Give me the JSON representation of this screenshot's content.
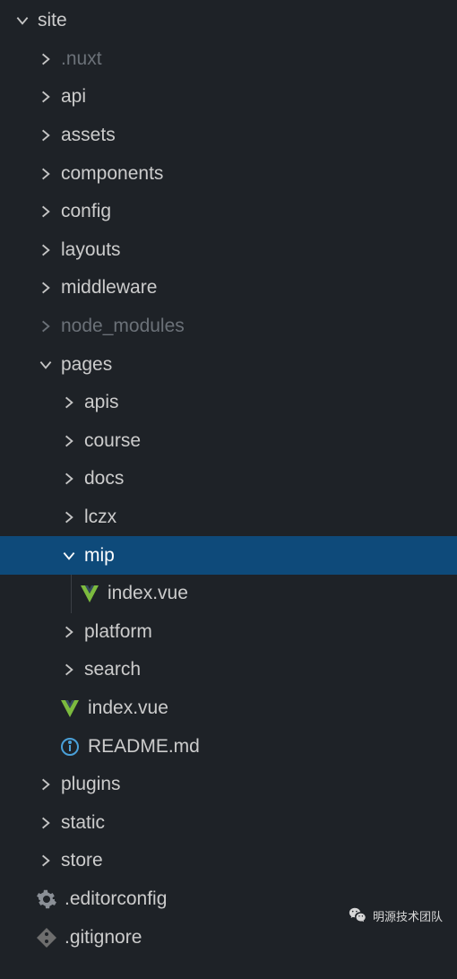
{
  "tree": {
    "root": "site",
    "items": {
      "site": {
        "label": "site",
        "type": "folder",
        "state": "open",
        "indent": 0,
        "muted": false
      },
      "nuxt": {
        "label": ".nuxt",
        "type": "folder",
        "state": "closed",
        "indent": 1,
        "muted": true
      },
      "api": {
        "label": "api",
        "type": "folder",
        "state": "closed",
        "indent": 1,
        "muted": false
      },
      "assets": {
        "label": "assets",
        "type": "folder",
        "state": "closed",
        "indent": 1,
        "muted": false
      },
      "components": {
        "label": "components",
        "type": "folder",
        "state": "closed",
        "indent": 1,
        "muted": false
      },
      "config": {
        "label": "config",
        "type": "folder",
        "state": "closed",
        "indent": 1,
        "muted": false
      },
      "layouts": {
        "label": "layouts",
        "type": "folder",
        "state": "closed",
        "indent": 1,
        "muted": false
      },
      "middleware": {
        "label": "middleware",
        "type": "folder",
        "state": "closed",
        "indent": 1,
        "muted": false
      },
      "node_modules": {
        "label": "node_modules",
        "type": "folder",
        "state": "closed",
        "indent": 1,
        "muted": true
      },
      "pages": {
        "label": "pages",
        "type": "folder",
        "state": "open",
        "indent": 1,
        "muted": false
      },
      "apis": {
        "label": "apis",
        "type": "folder",
        "state": "closed",
        "indent": 2,
        "muted": false
      },
      "course": {
        "label": "course",
        "type": "folder",
        "state": "closed",
        "indent": 2,
        "muted": false
      },
      "docs": {
        "label": "docs",
        "type": "folder",
        "state": "closed",
        "indent": 2,
        "muted": false
      },
      "lczx": {
        "label": "lczx",
        "type": "folder",
        "state": "closed",
        "indent": 2,
        "muted": false
      },
      "mip": {
        "label": "mip",
        "type": "folder",
        "state": "open",
        "indent": 2,
        "muted": false,
        "selected": true
      },
      "mip_index": {
        "label": "index.vue",
        "type": "file",
        "icon": "vue",
        "indent": 3,
        "muted": false
      },
      "platform": {
        "label": "platform",
        "type": "folder",
        "state": "closed",
        "indent": 2,
        "muted": false
      },
      "search": {
        "label": "search",
        "type": "folder",
        "state": "closed",
        "indent": 2,
        "muted": false
      },
      "pages_index": {
        "label": "index.vue",
        "type": "file",
        "icon": "vue",
        "indent": 2,
        "muted": false
      },
      "readme": {
        "label": "README.md",
        "type": "file",
        "icon": "info",
        "indent": 2,
        "muted": false
      },
      "plugins": {
        "label": "plugins",
        "type": "folder",
        "state": "closed",
        "indent": 1,
        "muted": false
      },
      "static": {
        "label": "static",
        "type": "folder",
        "state": "closed",
        "indent": 1,
        "muted": false
      },
      "store": {
        "label": "store",
        "type": "folder",
        "state": "closed",
        "indent": 1,
        "muted": false
      },
      "editorconfig": {
        "label": ".editorconfig",
        "type": "file",
        "icon": "gear",
        "indent": 1,
        "muted": false
      },
      "gitignore": {
        "label": ".gitignore",
        "type": "file",
        "icon": "git",
        "indent": 1,
        "muted": false
      }
    }
  },
  "badge": {
    "label": "明源技术团队"
  }
}
